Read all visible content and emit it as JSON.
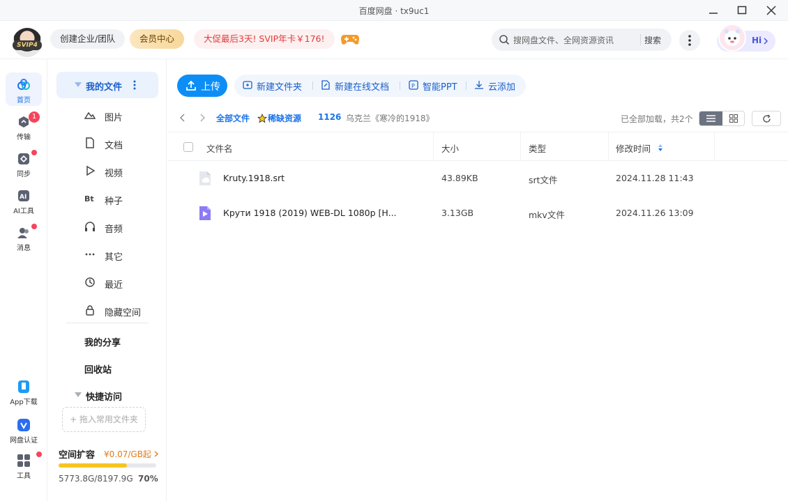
{
  "window": {
    "title": "百度网盘 · tx9uc1"
  },
  "header": {
    "vip_badge": "SVIP4",
    "biz_label": "创建企业/团队",
    "vip_center_label": "会员中心",
    "promo_label": "大促最后3天! SVIP年卡￥176!",
    "search_placeholder": "搜网盘文件、全网资源资讯",
    "search_button": "搜索",
    "hi_label": "Hi"
  },
  "rail": {
    "items": [
      {
        "label": "首页"
      },
      {
        "label": "传输",
        "badge": "1"
      },
      {
        "label": "同步"
      },
      {
        "label": "AI工具"
      },
      {
        "label": "消息"
      },
      {
        "label": "App下载"
      },
      {
        "label": "网盘认证"
      },
      {
        "label": "工具"
      }
    ]
  },
  "sidebar": {
    "my_files": "我的文件",
    "categories": [
      {
        "label": "图片",
        "icon": "image-icon"
      },
      {
        "label": "文档",
        "icon": "document-icon"
      },
      {
        "label": "视频",
        "icon": "video-icon"
      },
      {
        "label": "种子",
        "icon": "torrent-icon"
      },
      {
        "label": "音频",
        "icon": "audio-icon"
      },
      {
        "label": "其它",
        "icon": "more-icon"
      },
      {
        "label": "最近",
        "icon": "recent-icon"
      },
      {
        "label": "隐藏空间",
        "icon": "lock-icon"
      }
    ],
    "my_share": "我的分享",
    "recycle": "回收站",
    "quick_access": "快捷访问",
    "drop_hint": "+ 拖入常用文件夹",
    "space": {
      "title": "空间扩容",
      "price": "¥0.07/GB起",
      "used": "5773.8G/8197.9G",
      "percent_label": "70%",
      "fraction": 0.7
    }
  },
  "toolbar": {
    "upload": "上传",
    "new_folder": "新建文件夹",
    "new_doc": "新建在线文档",
    "ppt": "智能PPT",
    "cloud_add": "云添加"
  },
  "breadcrumb": {
    "root": "全部文件",
    "level1": "稀缺资源",
    "level2": "1126",
    "current": "乌克兰《寒冷的1918》",
    "status": "已全部加载，共2个"
  },
  "table": {
    "headers": {
      "name": "文件名",
      "size": "大小",
      "type": "类型",
      "modified": "修改时间"
    },
    "rows": [
      {
        "name": "Kruty.1918.srt",
        "size": "43.89KB",
        "type": "srt文件",
        "modified": "2024.11.28 11:43",
        "icon": "subtitle-file-icon"
      },
      {
        "name": "Крути 1918 (2019) WEB-DL 1080p [H...",
        "size": "3.13GB",
        "type": "mkv文件",
        "modified": "2024.11.26 13:09",
        "icon": "video-file-icon"
      }
    ]
  },
  "colors": {
    "accent": "#0d8ef7",
    "link": "#1a73e8",
    "badge": "#f5455c",
    "promo": "#e23b3b",
    "storage_bar": "#f7c521"
  }
}
